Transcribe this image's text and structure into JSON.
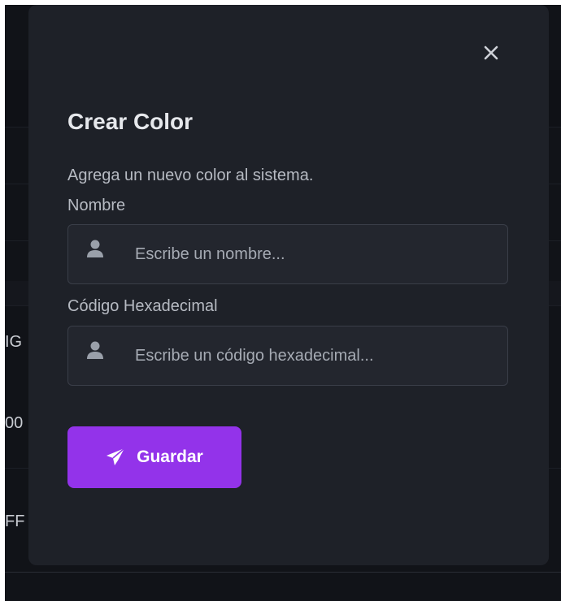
{
  "background": {
    "row_texts": [
      "IG",
      "00",
      "FF"
    ]
  },
  "modal": {
    "close_icon": "close-icon",
    "title": "Crear Color",
    "description": "Agrega un nuevo color al sistema.",
    "fields": [
      {
        "label": "Nombre",
        "icon": "user-icon",
        "value": "",
        "placeholder": "Escribe un nombre..."
      },
      {
        "label": "Código Hexadecimal",
        "icon": "user-icon",
        "value": "",
        "placeholder": "Escribe un código hexadecimal..."
      }
    ],
    "submit": {
      "icon": "paper-plane-icon",
      "label": "Guardar"
    }
  },
  "colors": {
    "modal_bg": "#1e2128",
    "backdrop": "#111318",
    "accent": "#9333ea",
    "input_bg": "#23262e",
    "input_border": "#3a3e48"
  }
}
